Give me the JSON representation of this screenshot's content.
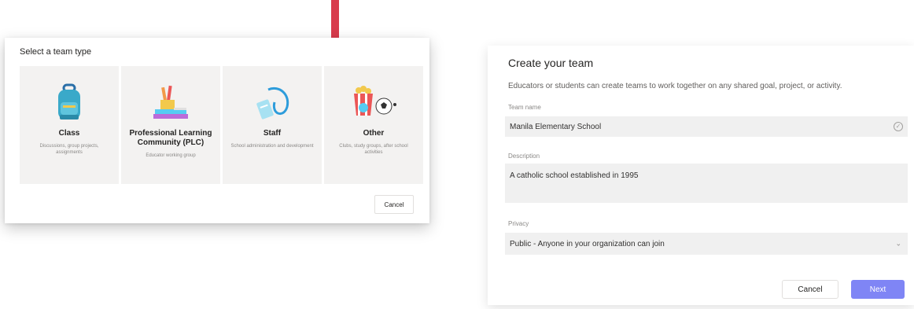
{
  "team_type_dialog": {
    "title": "Select a team type",
    "cards": [
      {
        "label": "Class",
        "description": "Discussions, group projects, assignments",
        "icon": "backpack-icon"
      },
      {
        "label": "Professional Learning Community (PLC)",
        "description": "Educator working group",
        "icon": "books-pencils-icon"
      },
      {
        "label": "Staff",
        "description": "School administration and development",
        "icon": "lanyard-badge-icon"
      },
      {
        "label": "Other",
        "description": "Clubs, study groups, after school activities",
        "icon": "popcorn-ball-icon"
      }
    ],
    "cancel_label": "Cancel"
  },
  "create_team_dialog": {
    "title": "Create your team",
    "subtitle": "Educators or students can create teams to work together on any shared goal, project, or activity.",
    "team_name_label": "Team name",
    "team_name_value": "Manila Elementary School",
    "description_label": "Description",
    "description_value": "A catholic school established in 1995",
    "privacy_label": "Privacy",
    "privacy_value": "Public - Anyone in your organization can join",
    "cancel_label": "Cancel",
    "next_label": "Next"
  },
  "colors": {
    "accent": "#7f85f5",
    "arrow": "#d83b4c",
    "card_bg": "#f3f2f1"
  }
}
